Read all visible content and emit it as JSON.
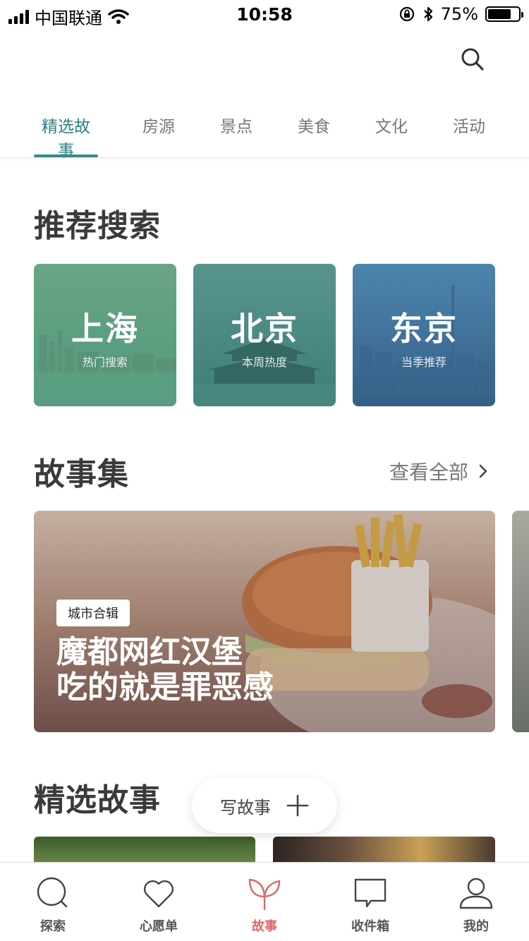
{
  "status_bar": {
    "carrier": "中国联通",
    "time": "10:58",
    "battery": "75%",
    "battery_level": 0.75
  },
  "header": {
    "search_icon": "search-icon"
  },
  "tabs": [
    {
      "label": "精选故事",
      "active": true
    },
    {
      "label": "房源",
      "active": false
    },
    {
      "label": "景点",
      "active": false
    },
    {
      "label": "美食",
      "active": false
    },
    {
      "label": "文化",
      "active": false
    },
    {
      "label": "活动",
      "active": false
    }
  ],
  "recommend": {
    "title": "推荐搜索",
    "cards": [
      {
        "city": "上海",
        "sub": "热门搜索",
        "color_top": "#6aa486",
        "color_bottom": "#4f9a7a"
      },
      {
        "city": "北京",
        "sub": "本周热度",
        "color_top": "#58948e",
        "color_bottom": "#3e7f78"
      },
      {
        "city": "东京",
        "sub": "当季推荐",
        "color_top": "#4d85ad",
        "color_bottom": "#355f87"
      }
    ]
  },
  "stories": {
    "title": "故事集",
    "see_all": "查看全部",
    "card": {
      "badge": "城市合辑",
      "title_line1": "魔都网红汉堡",
      "title_line2": "吃的就是罪恶感"
    }
  },
  "featured": {
    "title": "精选故事"
  },
  "write_button": {
    "label": "写故事"
  },
  "tab_bar": [
    {
      "label": "探索",
      "icon": "search-icon",
      "active": false
    },
    {
      "label": "心愿单",
      "icon": "heart-icon",
      "active": false
    },
    {
      "label": "故事",
      "icon": "sprout-icon",
      "active": true
    },
    {
      "label": "收件箱",
      "icon": "chat-bubble-icon",
      "active": false
    },
    {
      "label": "我的",
      "icon": "person-icon",
      "active": false
    }
  ],
  "colors": {
    "accent": "#2f7f80",
    "active_tab_bar": "#e06666"
  }
}
